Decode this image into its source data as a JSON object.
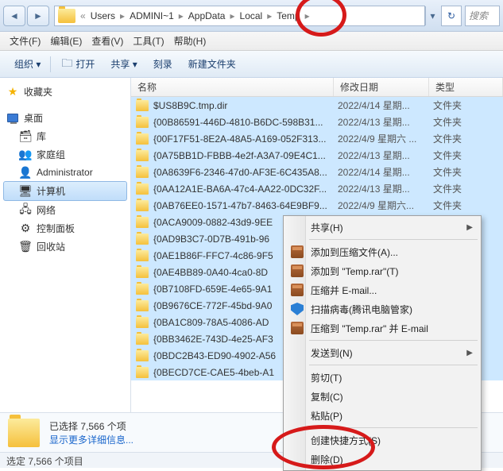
{
  "titlebar": {
    "breadcrumbs": [
      "Users",
      "ADMINI~1",
      "AppData",
      "Local",
      "Temp"
    ],
    "search_placeholder": "搜索"
  },
  "menubar": {
    "file": "文件(F)",
    "edit": "编辑(E)",
    "view": "查看(V)",
    "tools": "工具(T)",
    "help": "帮助(H)"
  },
  "toolbar": {
    "organize": "组织 ▾",
    "open": "打开",
    "share": "共享 ▾",
    "burn": "刻录",
    "newfolder": "新建文件夹"
  },
  "sidebar": {
    "favorites": "收藏夹",
    "desktop": "桌面",
    "libraries": "库",
    "homegroup": "家庭组",
    "administrator": "Administrator",
    "computer": "计算机",
    "network": "网络",
    "controlpanel": "控制面板",
    "recyclebin": "回收站"
  },
  "columns": {
    "name": "名称",
    "date": "修改日期",
    "type": "类型"
  },
  "type_folder": "文件夹",
  "files": [
    {
      "name": "$US8B9C.tmp.dir",
      "date": "2022/4/14 星期..."
    },
    {
      "name": "{00B86591-446D-4810-B6DC-598B31...",
      "date": "2022/4/13 星期..."
    },
    {
      "name": "{00F17F51-8E2A-48A5-A169-052F313...",
      "date": "2022/4/9 星期六 ..."
    },
    {
      "name": "{0A75BB1D-FBBB-4e2f-A3A7-09E4C1...",
      "date": "2022/4/13 星期..."
    },
    {
      "name": "{0A8639F6-2346-47d0-AF3E-6C435A8...",
      "date": "2022/4/14 星期..."
    },
    {
      "name": "{0AA12A1E-BA6A-47c4-AA22-0DC32F...",
      "date": "2022/4/13 星期..."
    },
    {
      "name": "{0AB76EE0-1571-47b7-8463-64E9BF9...",
      "date": "2022/4/9 星期六..."
    },
    {
      "name": "{0ACA9009-0882-43d9-9EE",
      "date": ""
    },
    {
      "name": "{0AD9B3C7-0D7B-491b-96",
      "date": ""
    },
    {
      "name": "{0AE1B86F-FFC7-4c86-9F5",
      "date": ""
    },
    {
      "name": "{0AE4BB89-0A40-4ca0-8D",
      "date": ""
    },
    {
      "name": "{0B7108FD-659E-4e65-9A1",
      "date": ""
    },
    {
      "name": "{0B9676CE-772F-45bd-9A0",
      "date": ""
    },
    {
      "name": "{0BA1C809-78A5-4086-AD",
      "date": ""
    },
    {
      "name": "{0BB3462E-743D-4e25-AF3",
      "date": ""
    },
    {
      "name": "{0BDC2B43-ED90-4902-A56",
      "date": ""
    },
    {
      "name": "{0BECD7CE-CAE5-4beb-A1",
      "date": ""
    }
  ],
  "context_menu": {
    "share": "共享(H)",
    "add_archive": "添加到压缩文件(A)...",
    "add_temp": "添加到 \"Temp.rar\"(T)",
    "compress_email": "压缩并 E-mail...",
    "scan": "扫描病毒(腾讯电脑管家)",
    "compress_temp_email": "压缩到 \"Temp.rar\" 并 E-mail",
    "sendto": "发送到(N)",
    "cut": "剪切(T)",
    "copy": "复制(C)",
    "paste": "粘贴(P)",
    "create_shortcut": "创建快捷方式(S)",
    "delete": "删除(D)"
  },
  "details": {
    "line1": "已选择 7,566 个项",
    "line2": "显示更多详细信息..."
  },
  "statusbar": {
    "text": "选定 7,566 个项目"
  }
}
